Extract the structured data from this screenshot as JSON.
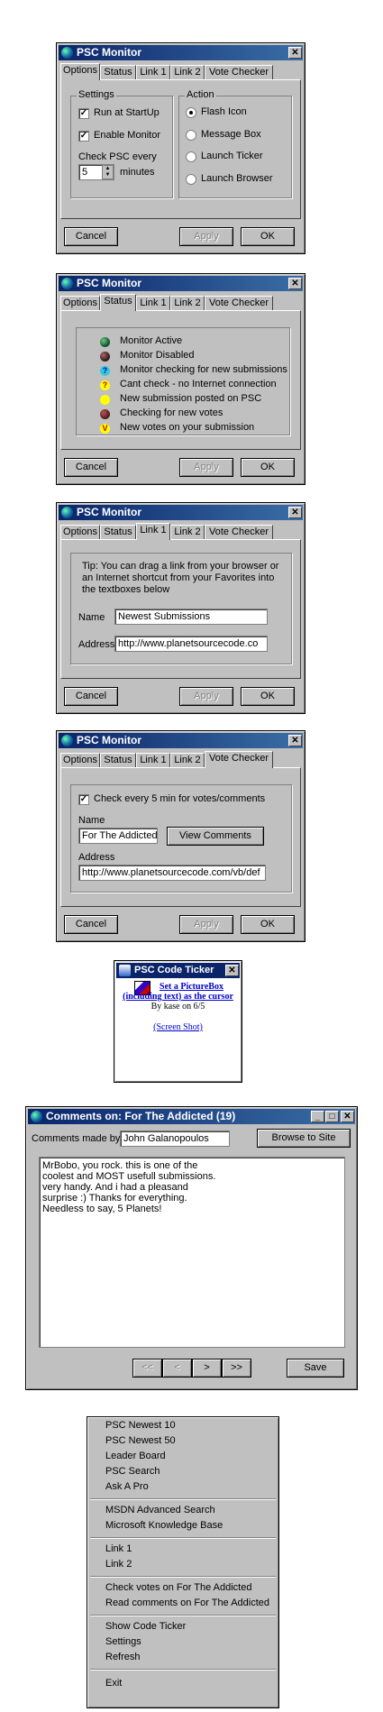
{
  "app_title": "PSC Monitor",
  "tabs": [
    "Options",
    "Status",
    "Link 1",
    "Link 2",
    "Vote Checker"
  ],
  "buttons": {
    "cancel": "Cancel",
    "apply": "Apply",
    "ok": "OK"
  },
  "options": {
    "settings_title": "Settings",
    "run_startup": "Run at StartUp",
    "enable_monitor": "Enable Monitor",
    "check_every": "Check PSC every",
    "minutes_value": "5",
    "minutes_label": "minutes",
    "action_title": "Action",
    "actions": [
      "Flash Icon",
      "Message Box",
      "Launch Ticker",
      "Launch Browser"
    ]
  },
  "status": {
    "items": [
      "Monitor Active",
      "Monitor Disabled",
      "Monitor checking for new submissions",
      "Cant check - no Internet connection",
      "New submission posted on PSC",
      "Checking for new votes",
      "New votes on your submission"
    ],
    "colors": [
      "#1b5a2e",
      "#3b1f1f",
      "#33cccc",
      "#ffff00",
      "#ffff00",
      "#5a2020",
      "#ffff00"
    ],
    "glyphs": [
      "",
      "",
      "?",
      "?",
      "",
      "",
      "V"
    ]
  },
  "link1": {
    "tip": "Tip: You can drag a link from your browser or an Internet shortcut from your Favorites into the textboxes below",
    "name_label": "Name",
    "name_value": "Newest Submissions",
    "address_label": "Address",
    "address_value": "http://www.planetsourcecode.co"
  },
  "vote": {
    "check_label": "Check every 5 min for votes/comments",
    "name_label": "Name",
    "name_value": "For The Addicted",
    "view_comments": "View Comments",
    "address_label": "Address",
    "address_value": "http://www.planetsourcecode.com/vb/def"
  },
  "ticker": {
    "title": "PSC Code Ticker",
    "link_text_1": "Set a PictureBox",
    "link_text_2": "(including text) as the cursor",
    "byline": "By kase on 6/5",
    "screenshot": "(Screen Shot)"
  },
  "comments": {
    "title": "Comments on: For The Addicted (19)",
    "made_by_label": "Comments made by:",
    "made_by_value": "John Galanopoulos",
    "browse": "Browse to Site",
    "text_lines": [
      "MrBobo, you rock. this is one of the",
      "coolest and MOST usefull submissions.",
      "very handy. And i had a pleasand",
      "surprise :) Thanks for everything.",
      "Needless to say, 5 Planets!"
    ],
    "nav": [
      "<<",
      "<",
      ">",
      ">>"
    ],
    "save": "Save"
  },
  "menu": {
    "groups": [
      [
        "PSC Newest 10",
        "PSC Newest 50",
        "Leader Board",
        "PSC Search",
        "Ask A Pro"
      ],
      [
        "MSDN Advanced Search",
        "Microsoft Knowledge Base"
      ],
      [
        "Link 1",
        "Link 2"
      ],
      [
        "Check votes on For The Addicted",
        "Read comments on For The Addicted"
      ],
      [
        "Show Code Ticker",
        "Settings",
        "Refresh"
      ],
      [
        "Exit"
      ]
    ]
  }
}
